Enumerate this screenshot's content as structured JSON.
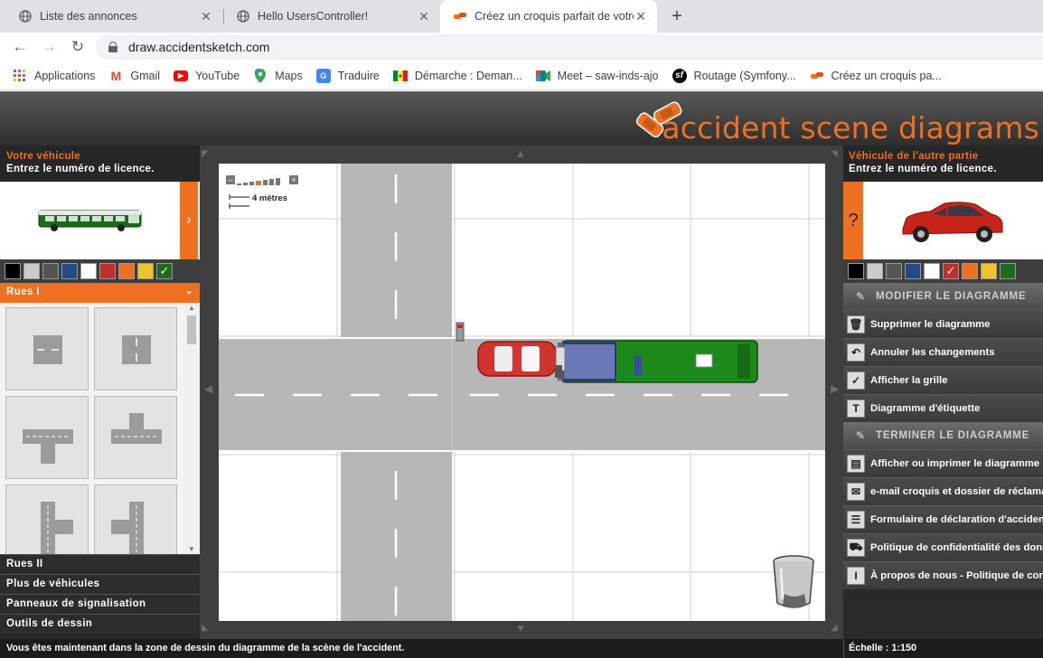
{
  "browser": {
    "tabs": [
      {
        "title": "Liste des annonces",
        "icon": "globe-icon"
      },
      {
        "title": "Hello UsersController!",
        "icon": "globe-icon"
      },
      {
        "title": "Créez un croquis parfait de votre",
        "icon": "car-crash-icon"
      }
    ],
    "url": "draw.accidentsketch.com",
    "bookmarks": [
      {
        "label": "Applications",
        "icon": "apps-grid-icon"
      },
      {
        "label": "Gmail",
        "icon": "gmail-icon"
      },
      {
        "label": "YouTube",
        "icon": "youtube-icon"
      },
      {
        "label": "Maps",
        "icon": "maps-pin-icon"
      },
      {
        "label": "Traduire",
        "icon": "translate-icon"
      },
      {
        "label": "Démarche : Deman...",
        "icon": "flag-icon"
      },
      {
        "label": "Meet – saw-inds-ajo",
        "icon": "meet-icon"
      },
      {
        "label": "Routage (Symfony...",
        "icon": "symfony-icon"
      },
      {
        "label": "Créez un croquis pa...",
        "icon": "car-crash-icon"
      }
    ]
  },
  "app": {
    "logo": "accident scene diagrams",
    "left": {
      "title": "Votre véhicule",
      "subtitle": "Entrez le numéro de licence.",
      "vehicle": "bus",
      "arrow": "›",
      "colors": [
        "#000000",
        "#cccccc",
        "#555555",
        "#234a87",
        "#ffffff",
        "#c0302a",
        "#ee7122",
        "#f2c12e",
        "#1e6b1e"
      ],
      "selected_color": "#1e6b1e",
      "sections": [
        "Rues I",
        "Rues II",
        "Plus de véhicules",
        "Panneaux de signalisation",
        "Outils de dessin"
      ],
      "open_section": "Rues I"
    },
    "canvas": {
      "scale_label": "4 mètres",
      "zoom_minus": "–",
      "zoom_plus": "+"
    },
    "right": {
      "title": "Véhicule de l'autre partie",
      "subtitle": "Entrez le numéro de licence.",
      "vehicle": "red SUV",
      "question": "?",
      "colors": [
        "#000000",
        "#cccccc",
        "#555555",
        "#234a87",
        "#ffffff",
        "#c0302a",
        "#ee7122",
        "#f2c12e",
        "#1e6b1e"
      ],
      "selected_color": "#c0302a",
      "section_modify": "MODIFIER LE DIAGRAMME",
      "modify_items": [
        {
          "label": "Supprimer le diagramme",
          "icon": "trash-icon"
        },
        {
          "label": "Annuler les changements",
          "icon": "undo-icon"
        },
        {
          "label": "Afficher la grille",
          "icon": "grid-check-icon"
        },
        {
          "label": "Diagramme d'étiquette",
          "icon": "text-label-icon"
        }
      ],
      "section_finish": "TERMINER LE DIAGRAMME",
      "finish_items": [
        {
          "label": "Afficher ou imprimer le diagramme",
          "icon": "print-icon"
        },
        {
          "label": "e-mail croquis et dossier de réclamation",
          "icon": "email-icon"
        },
        {
          "label": "Formulaire de déclaration d'accident",
          "icon": "form-icon"
        },
        {
          "label": "Politique de confidentialité des données",
          "icon": "privacy-car-icon"
        },
        {
          "label": "À propos de nous - Politique de confidentialité",
          "icon": "info-icon"
        }
      ]
    },
    "status": {
      "message": "Vous êtes maintenant dans la zone de dessin du diagramme de la scène de l'accident.",
      "scale": "Échelle : 1:150"
    }
  }
}
